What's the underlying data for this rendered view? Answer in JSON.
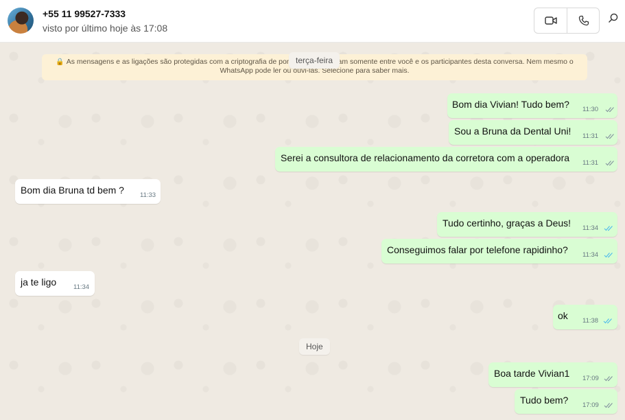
{
  "header": {
    "contact_name": "+55 11 99527-7333",
    "status": "visto por último hoje às 17:08",
    "icons": [
      "video-call-icon",
      "voice-call-icon",
      "search-icon"
    ]
  },
  "notice": {
    "text_a": "As mensagens e as ligações são protegidas com a criptografia de ponta a ponta e ficam somente entre você e os participantes desta conversa. Nem mesmo o",
    "text_b": "WhatsApp pode ler ou ouvi-las. Selecione para saber mais."
  },
  "day_labels": {
    "tuesday": "terça-feira",
    "today": "Hoje"
  },
  "messages": [
    {
      "text": "Bom dia Vivian! Tudo bem?",
      "time": "11:30",
      "direction": "out",
      "status": "delivered"
    },
    {
      "text": "Sou a Bruna da Dental Uni!",
      "time": "11:31",
      "direction": "out",
      "status": "delivered"
    },
    {
      "text": "Serei a consultora de relacionamento da corretora com a operadora",
      "time": "11:31",
      "direction": "out",
      "status": "delivered"
    },
    {
      "text": "Bom dia Bruna td bem ?",
      "time": "11:33",
      "direction": "in"
    },
    {
      "text": "Tudo certinho, graças a Deus!",
      "time": "11:34",
      "direction": "out",
      "status": "read"
    },
    {
      "text": "Conseguimos falar por telefone rapidinho?",
      "time": "11:34",
      "direction": "out",
      "status": "read"
    },
    {
      "text": "ja te ligo",
      "time": "11:34",
      "direction": "in"
    },
    {
      "text": "ok",
      "time": "11:38",
      "direction": "out",
      "status": "read"
    },
    {
      "text": "Boa tarde Vivian1",
      "time": "17:09",
      "direction": "out",
      "status": "delivered"
    },
    {
      "text": "Tudo bem?",
      "time": "17:09",
      "direction": "out",
      "status": "delivered"
    }
  ],
  "colors": {
    "outgoing_bubble": "#d9fdd3",
    "incoming_bubble": "#ffffff",
    "read_tick": "#53bdeb",
    "delivered_tick": "#8696a0",
    "notice_bg": "#fdf1d6",
    "chat_bg": "#efeae2"
  }
}
